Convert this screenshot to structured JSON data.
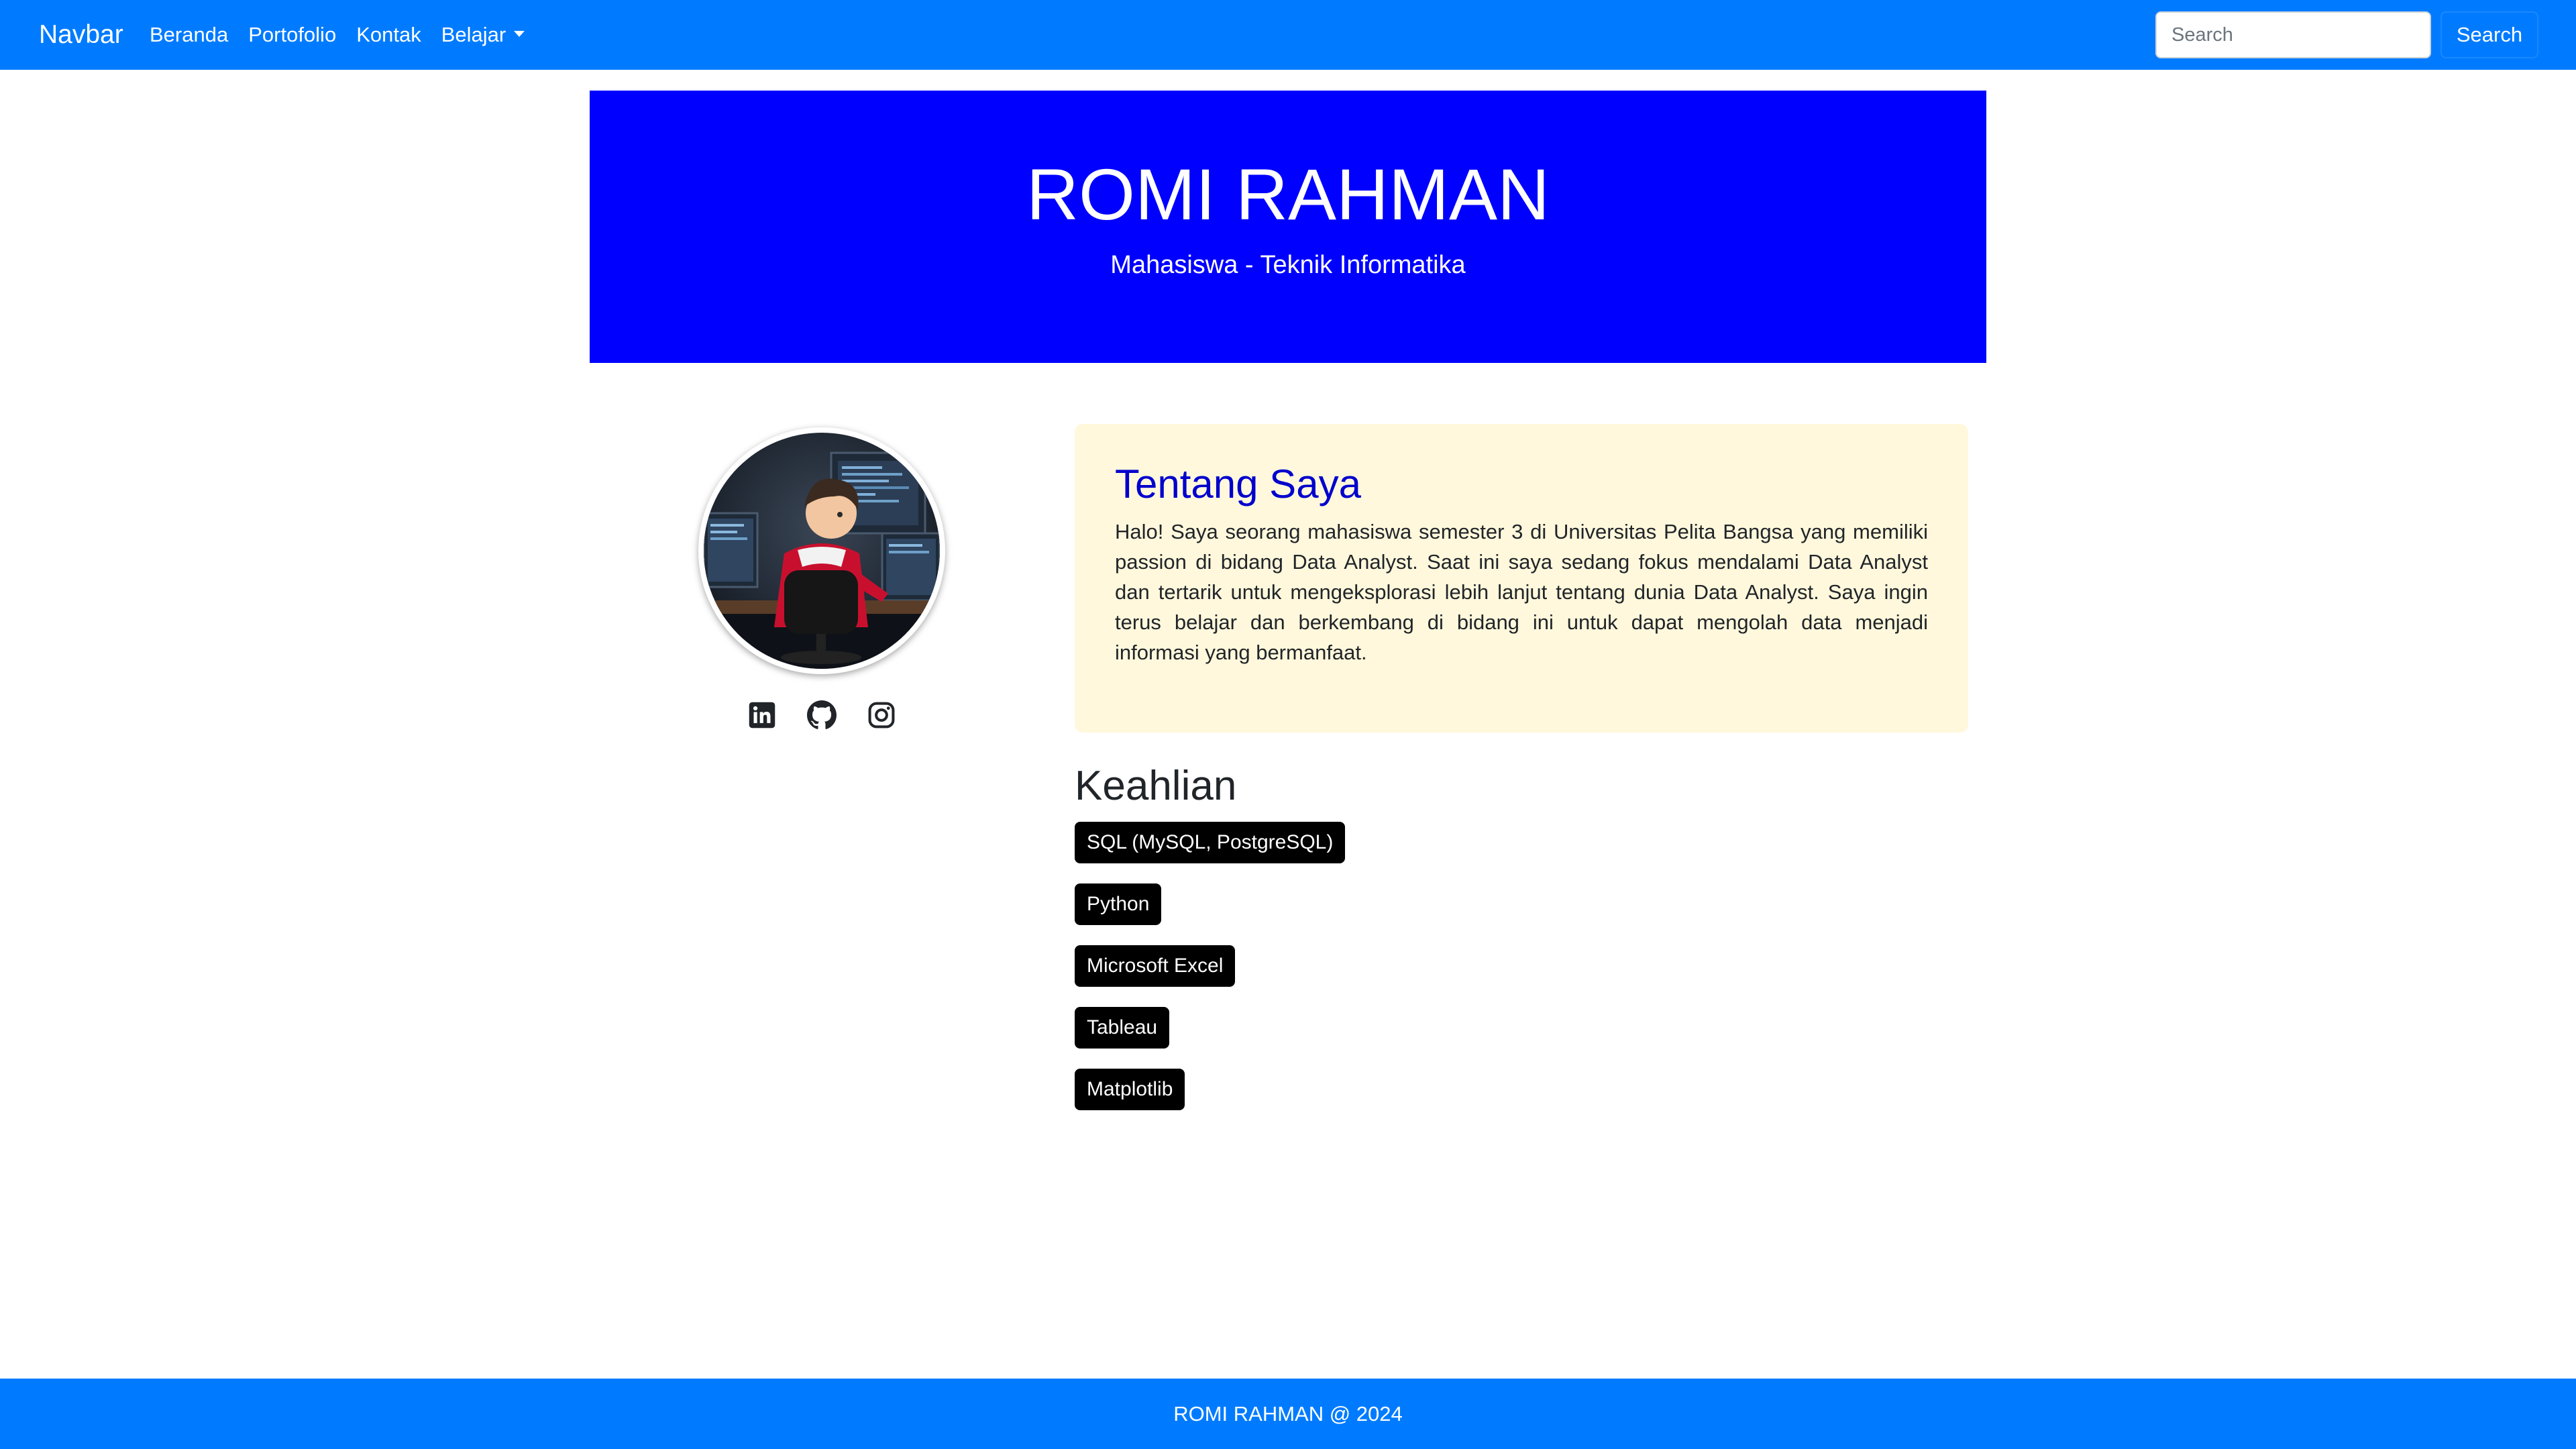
{
  "navbar": {
    "brand": "Navbar",
    "links": [
      {
        "label": "Beranda"
      },
      {
        "label": "Portofolio"
      },
      {
        "label": "Kontak"
      },
      {
        "label": "Belajar"
      }
    ],
    "search_placeholder": "Search",
    "search_button": "Search",
    "background": "#007bff"
  },
  "hero": {
    "title": "ROMI RAHMAN",
    "subtitle": "Mahasiswa - Teknik Informatika",
    "background": "#0000ff"
  },
  "profile": {
    "socials": [
      {
        "icon": "linkedin-icon"
      },
      {
        "icon": "github-icon"
      },
      {
        "icon": "instagram-icon"
      }
    ]
  },
  "about": {
    "title": "Tentang Saya",
    "text": "Halo! Saya seorang mahasiswa semester 3 di Universitas Pelita Bangsa yang memiliki passion di bidang Data Analyst. Saat ini saya sedang fokus mendalami Data Analyst dan tertarik untuk mengeksplorasi lebih lanjut tentang dunia Data Analyst. Saya ingin terus belajar dan berkembang di bidang ini untuk dapat mengolah data menjadi informasi yang bermanfaat.",
    "background": "#fff8dc",
    "title_color": "#0000cd"
  },
  "skills": {
    "title": "Keahlian",
    "items": [
      "SQL (MySQL, PostgreSQL)",
      "Python",
      "Microsoft Excel",
      "Tableau",
      "Matplotlib"
    ]
  },
  "footer": {
    "text": "ROMI RAHMAN @ 2024"
  }
}
